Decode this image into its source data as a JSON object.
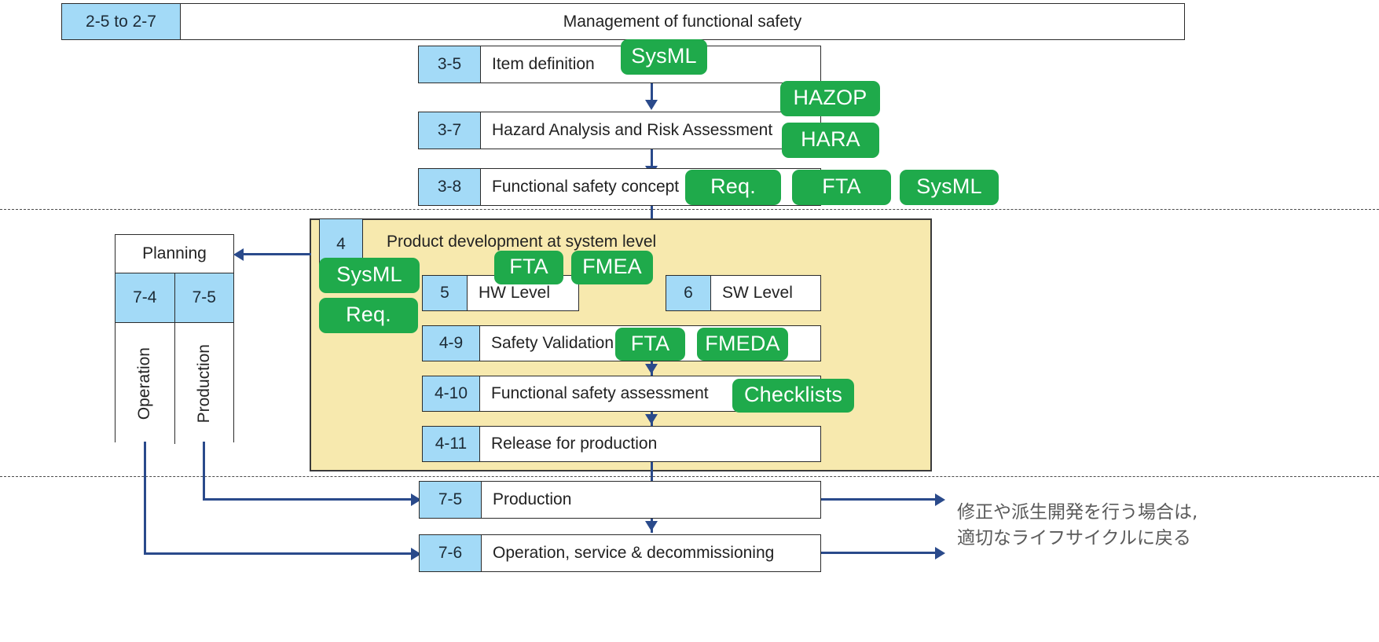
{
  "banner": {
    "code": "2-5 to 2-7",
    "title": "Management of functional safety"
  },
  "concept_rows": [
    {
      "code": "3-5",
      "label": "Item definition"
    },
    {
      "code": "3-7",
      "label": "Hazard Analysis and Risk Assessment"
    },
    {
      "code": "3-8",
      "label": "Functional safety concept"
    }
  ],
  "phase": {
    "code": "4",
    "title": "Product development at system level",
    "sub_levels": [
      {
        "code": "5",
        "label": "HW Level"
      },
      {
        "code": "6",
        "label": "SW Level"
      }
    ],
    "rows": [
      {
        "code": "4-9",
        "label": "Safety Validation"
      },
      {
        "code": "4-10",
        "label": "Functional safety assessment"
      },
      {
        "code": "4-11",
        "label": "Release for production"
      }
    ]
  },
  "bottom_rows": [
    {
      "code": "7-5",
      "label": "Production"
    },
    {
      "code": "7-6",
      "label": "Operation, service & decommissioning"
    }
  ],
  "planning_table": {
    "header": "Planning",
    "codes": [
      "7-4",
      "7-5"
    ],
    "vertical_labels": [
      "Operation",
      "Production"
    ]
  },
  "badges": [
    {
      "id": "badge-sysml-item",
      "text": "SysML"
    },
    {
      "id": "badge-hazop",
      "text": "HAZOP"
    },
    {
      "id": "badge-hara",
      "text": "HARA"
    },
    {
      "id": "badge-req-concept",
      "text": "Req."
    },
    {
      "id": "badge-fta-concept",
      "text": "FTA"
    },
    {
      "id": "badge-sysml-concept",
      "text": "SysML"
    },
    {
      "id": "badge-fta-system",
      "text": "FTA"
    },
    {
      "id": "badge-fmea-system",
      "text": "FMEA"
    },
    {
      "id": "badge-sysml-system",
      "text": "SysML"
    },
    {
      "id": "badge-req-system",
      "text": "Req."
    },
    {
      "id": "badge-fta-validation",
      "text": "FTA"
    },
    {
      "id": "badge-fmeda-validation",
      "text": "FMEDA"
    },
    {
      "id": "badge-checklists",
      "text": "Checklists"
    }
  ],
  "note": {
    "text": "修正や派生開発を行う場合は,\n適切なライフサイクルに戻る"
  },
  "colors": {
    "code_cell": "#a3daf7",
    "badge_green": "#1faa4b",
    "phase_yellow": "#f7e9ae",
    "connector_blue": "#2a4a8b",
    "border": "#2b2b2b"
  }
}
